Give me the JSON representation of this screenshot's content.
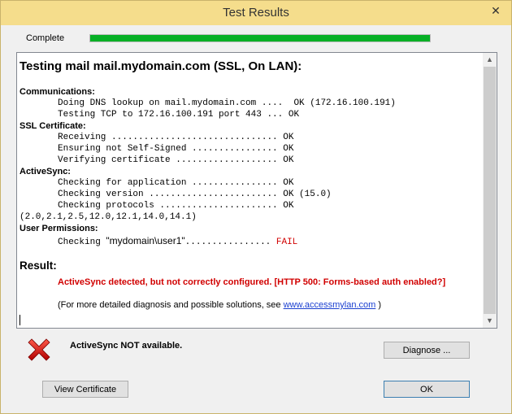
{
  "window": {
    "title": "Test Results",
    "close_glyph": "✕"
  },
  "progress": {
    "label": "Complete",
    "fraction": 1.0,
    "color": "#06b025"
  },
  "report": {
    "heading": "Testing mail mail.mydomain.com (SSL, On LAN):",
    "sections": {
      "communications": "Communications:",
      "ssl": "SSL Certificate:",
      "activesync": "ActiveSync:",
      "permissions": "User Permissions:"
    },
    "lines": {
      "dns": "Doing DNS lookup on mail.mydomain.com ....  OK (172.16.100.191)",
      "tcp": "Testing TCP to 172.16.100.191 port 443 ... OK",
      "receiving": "Receiving ............................... OK",
      "self_signed": "Ensuring not Self-Signed ................ OK",
      "verifying": "Verifying certificate ................... OK",
      "application": "Checking for application ................ OK",
      "version": "Checking version ........................ OK (15.0)",
      "protocols": "Checking protocols ...................... OK",
      "protocol_list": "(2.0,2.1,2.5,12.0,12.1,14.0,14.1)",
      "checking_prefix": "Checking ",
      "checking_user": "\"mydomain\\user1\"",
      "checking_dots": "................ ",
      "checking_status": "FAIL"
    },
    "result_heading": "Result:",
    "result_message": "ActiveSync detected, but not correctly configured. [HTTP 500: Forms-based auth enabled?]",
    "info_prefix": "(For more detailed diagnosis and possible solutions, see ",
    "info_link": "www.accessmylan.com",
    "info_suffix": " )"
  },
  "status": {
    "icon": "error-x-icon",
    "text": "ActiveSync NOT available."
  },
  "buttons": {
    "diagnose": "Diagnose ...",
    "view_certificate": "View Certificate",
    "ok": "OK"
  },
  "colors": {
    "title_bar": "#f5dd8c",
    "error": "#d10000",
    "link": "#1a3fd0"
  }
}
